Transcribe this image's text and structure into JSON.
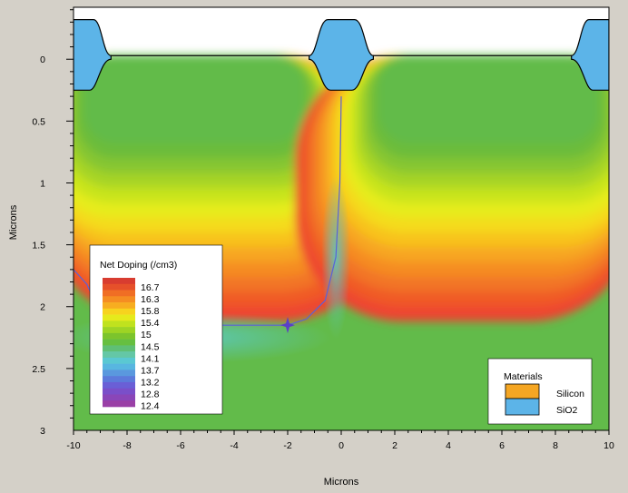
{
  "chart_data": {
    "type": "heatmap",
    "title": "",
    "xlabel": "Microns",
    "ylabel": "Microns",
    "xlim": [
      -10,
      10
    ],
    "ylim": [
      3,
      -0.42
    ],
    "x_ticks": [
      "-10",
      "-8",
      "-6",
      "-4",
      "-2",
      "0",
      "2",
      "4",
      "6",
      "8",
      "10"
    ],
    "x_tick_values": [
      -10,
      -8,
      -6,
      -4,
      -2,
      0,
      2,
      4,
      6,
      8,
      10
    ],
    "y_ticks": [
      "0",
      "0.5",
      "1",
      "1.5",
      "2",
      "2.5",
      "3"
    ],
    "y_tick_values": [
      0,
      0.5,
      1,
      1.5,
      2,
      2.5,
      3
    ],
    "colorbar": {
      "title": "Net Doping (/cm3)",
      "labels": [
        "16.7",
        "16.3",
        "15.8",
        "15.4",
        "15",
        "14.5",
        "14.1",
        "13.7",
        "13.2",
        "12.8",
        "12.4"
      ],
      "colors": [
        "#d83c30",
        "#e6502a",
        "#f06e24",
        "#f58d22",
        "#f7ad20",
        "#f7d31e",
        "#e6ea1c",
        "#c0e21e",
        "#9ed424",
        "#7cc42c",
        "#66bf40",
        "#5fbf75",
        "#64c7a6",
        "#5ac8d2",
        "#58b6e0",
        "#5a98de",
        "#5c7adb",
        "#6a5fd6",
        "#7a4fc9",
        "#8a46b8",
        "#9a40a6"
      ]
    },
    "legend": {
      "title": "Materials",
      "items": [
        {
          "name": "Silicon",
          "color": "#f5a623"
        },
        {
          "name": "SiO2",
          "color": "#5cb4e8"
        }
      ]
    },
    "level_colors": [
      "#ee4430",
      "#f05a28",
      "#f27426",
      "#f58c22",
      "#f7a620",
      "#f8c21e",
      "#f4dc1c",
      "#e6ec1c",
      "#c8e41e",
      "#a6d426",
      "#86c630",
      "#6cbc3a",
      "#62bb4a"
    ],
    "cells": [
      {
        "x": [
          -9.6,
          -1.4
        ],
        "depth": [
          0.3,
          0.68
        ]
      },
      {
        "x": [
          1.4,
          9.6
        ],
        "depth": [
          0.3,
          0.68
        ]
      }
    ],
    "junction_curve": [
      [
        -10,
        1.7
      ],
      [
        -9.5,
        1.82
      ],
      [
        -9,
        2.05
      ],
      [
        -8,
        2.14
      ],
      [
        -6,
        2.15
      ],
      [
        -4,
        2.15
      ],
      [
        -2,
        2.15
      ],
      [
        -1.3,
        2.1
      ],
      [
        -0.6,
        1.95
      ],
      [
        -0.2,
        1.6
      ],
      [
        -0.05,
        1.0
      ],
      [
        0,
        0.3
      ]
    ],
    "background_color": "#62bb4a",
    "oxide_color": "#5cb4e8"
  }
}
